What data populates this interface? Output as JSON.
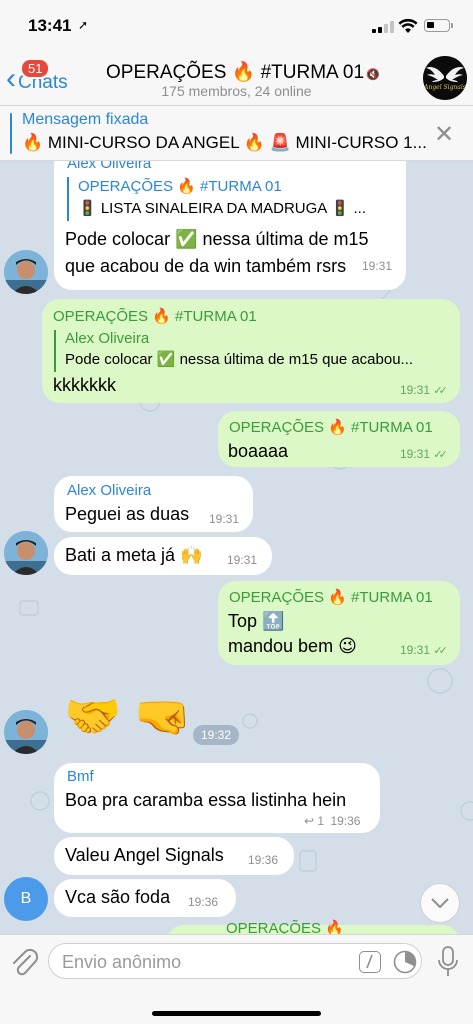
{
  "status_bar": {
    "time": "13:41"
  },
  "nav": {
    "back_label": "Chats",
    "unread_badge": "51",
    "title": "OPERAÇÕES 🔥 #TURMA 01",
    "subtitle": "175 membros, 24 online",
    "avatar_caption": "Angel Signals"
  },
  "pinned": {
    "title": "Mensagem fixada",
    "text": "🔥 MINI-CURSO DA ANGEL 🔥 🚨 MINI-CURSO 1..."
  },
  "messages": {
    "m1": {
      "sender_partial": "Alex Oliveira",
      "quote_name": "OPERAÇÕES 🔥 #TURMA 01",
      "quote_text": "🚦 LISTA SINALEIRA DA MADRUGA 🚦 ...",
      "text_line1": "Pode colocar ✅ nessa última de m15",
      "text_line2": "que acabou de da win também rsrs",
      "time": "19:31"
    },
    "m2": {
      "forward_header": "OPERAÇÕES 🔥 #TURMA 01",
      "quote_name": "Alex Oliveira",
      "quote_text": "Pode colocar ✅ nessa última de m15 que acabou...",
      "text": "kkkkkkk",
      "time": "19:31"
    },
    "m3": {
      "forward_header": "OPERAÇÕES 🔥 #TURMA 01",
      "text": "boaaaa",
      "time": "19:31"
    },
    "m4": {
      "sender": "Alex Oliveira",
      "text": "Peguei as duas",
      "time": "19:31"
    },
    "m5": {
      "text": "Bati a meta já 🙌",
      "time": "19:31"
    },
    "m6": {
      "forward_header": "OPERAÇÕES 🔥 #TURMA 01",
      "text_line1": "Top 🔝",
      "text_line2": "mandou bem 😉",
      "time": "19:31"
    },
    "m7": {
      "stickers": "🤝 🤜",
      "time": "19:32"
    },
    "m8": {
      "sender": "Bmf",
      "text": "Boa pra caramba essa listinha hein",
      "replies": "1",
      "time": "19:36"
    },
    "m9": {
      "text": "Valeu Angel Signals",
      "time": "19:36"
    },
    "m10": {
      "avatar_letter": "B",
      "text": "Vca são foda",
      "time": "19:36"
    },
    "m11": {
      "partial_header": "OPERAÇÕES 🔥"
    }
  },
  "input": {
    "placeholder": "Envio anônimo"
  },
  "colors": {
    "accent": "#2a86d8",
    "outgoing_bubble": "#dcf8c6",
    "incoming_bubble": "#ffffff",
    "chat_background": "#d3dee9",
    "badge": "#e8483c"
  }
}
